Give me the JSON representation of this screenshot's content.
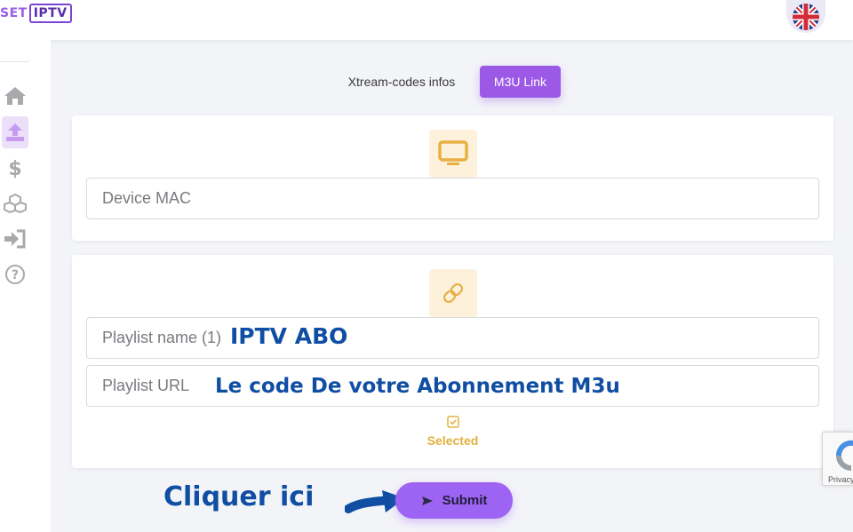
{
  "header": {
    "logo_set": "SET",
    "logo_iptv": "IPTV",
    "language_icon": "uk-flag-icon"
  },
  "sidebar": {
    "items": [
      {
        "icon": "home-icon",
        "active": false
      },
      {
        "icon": "upload-icon",
        "active": true
      },
      {
        "icon": "dollar-icon",
        "active": false
      },
      {
        "icon": "cubes-icon",
        "active": false
      },
      {
        "icon": "sign-in-icon",
        "active": false
      },
      {
        "icon": "help-icon",
        "active": false
      }
    ]
  },
  "tabs": {
    "xtream": "Xtream-codes infos",
    "m3u": "M3U Link",
    "active": "m3u"
  },
  "device_card": {
    "icon": "monitor-icon",
    "mac_placeholder": "Device MAC"
  },
  "playlist_card": {
    "icon": "link-icon",
    "name_placeholder": "Playlist name (1)",
    "url_placeholder": "Playlist URL",
    "selected_label": "Selected"
  },
  "annotations": {
    "playlist_name": "IPTV ABO",
    "playlist_url": "Le code De votre Abonnement M3u",
    "cliquer": "Cliquer ici"
  },
  "submit": {
    "label": "Submit"
  },
  "recaptcha": {
    "label": "Privacy"
  },
  "colors": {
    "accent": "#9b59e6",
    "icon_bg": "#fdf1dc",
    "icon_color": "#e8b043",
    "annotation": "#0f4ea3"
  }
}
